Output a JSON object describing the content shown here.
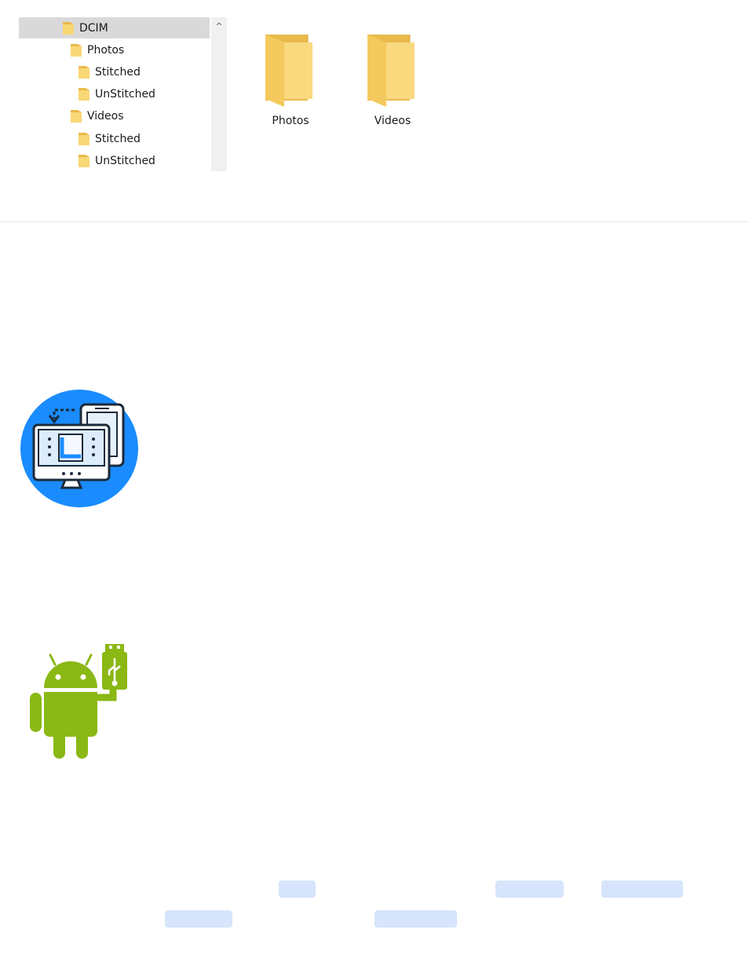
{
  "explorer": {
    "tree": [
      {
        "label": "DCIM",
        "level": 0,
        "selected": true
      },
      {
        "label": "Photos",
        "level": 1,
        "selected": false
      },
      {
        "label": "Stitched",
        "level": 2,
        "selected": false
      },
      {
        "label": "UnStitched",
        "level": 2,
        "selected": false
      },
      {
        "label": "Videos",
        "level": 1,
        "selected": false
      },
      {
        "label": "Stitched",
        "level": 2,
        "selected": false
      },
      {
        "label": "UnStitched",
        "level": 2,
        "selected": false
      }
    ],
    "scroll_up_glyph": "^",
    "folders": [
      {
        "label": "Photos"
      },
      {
        "label": "Videos"
      }
    ]
  },
  "icons": {
    "transfer": "pc-phone-transfer-icon",
    "android": "android-usb-icon"
  },
  "colors": {
    "folder": "#f8d775",
    "folder_dark": "#e9b949",
    "selection": "#d9d9d9",
    "transfer_bg": "#1a8cff",
    "android_green": "#8ab814",
    "link_pill": "#d6e5fb"
  }
}
